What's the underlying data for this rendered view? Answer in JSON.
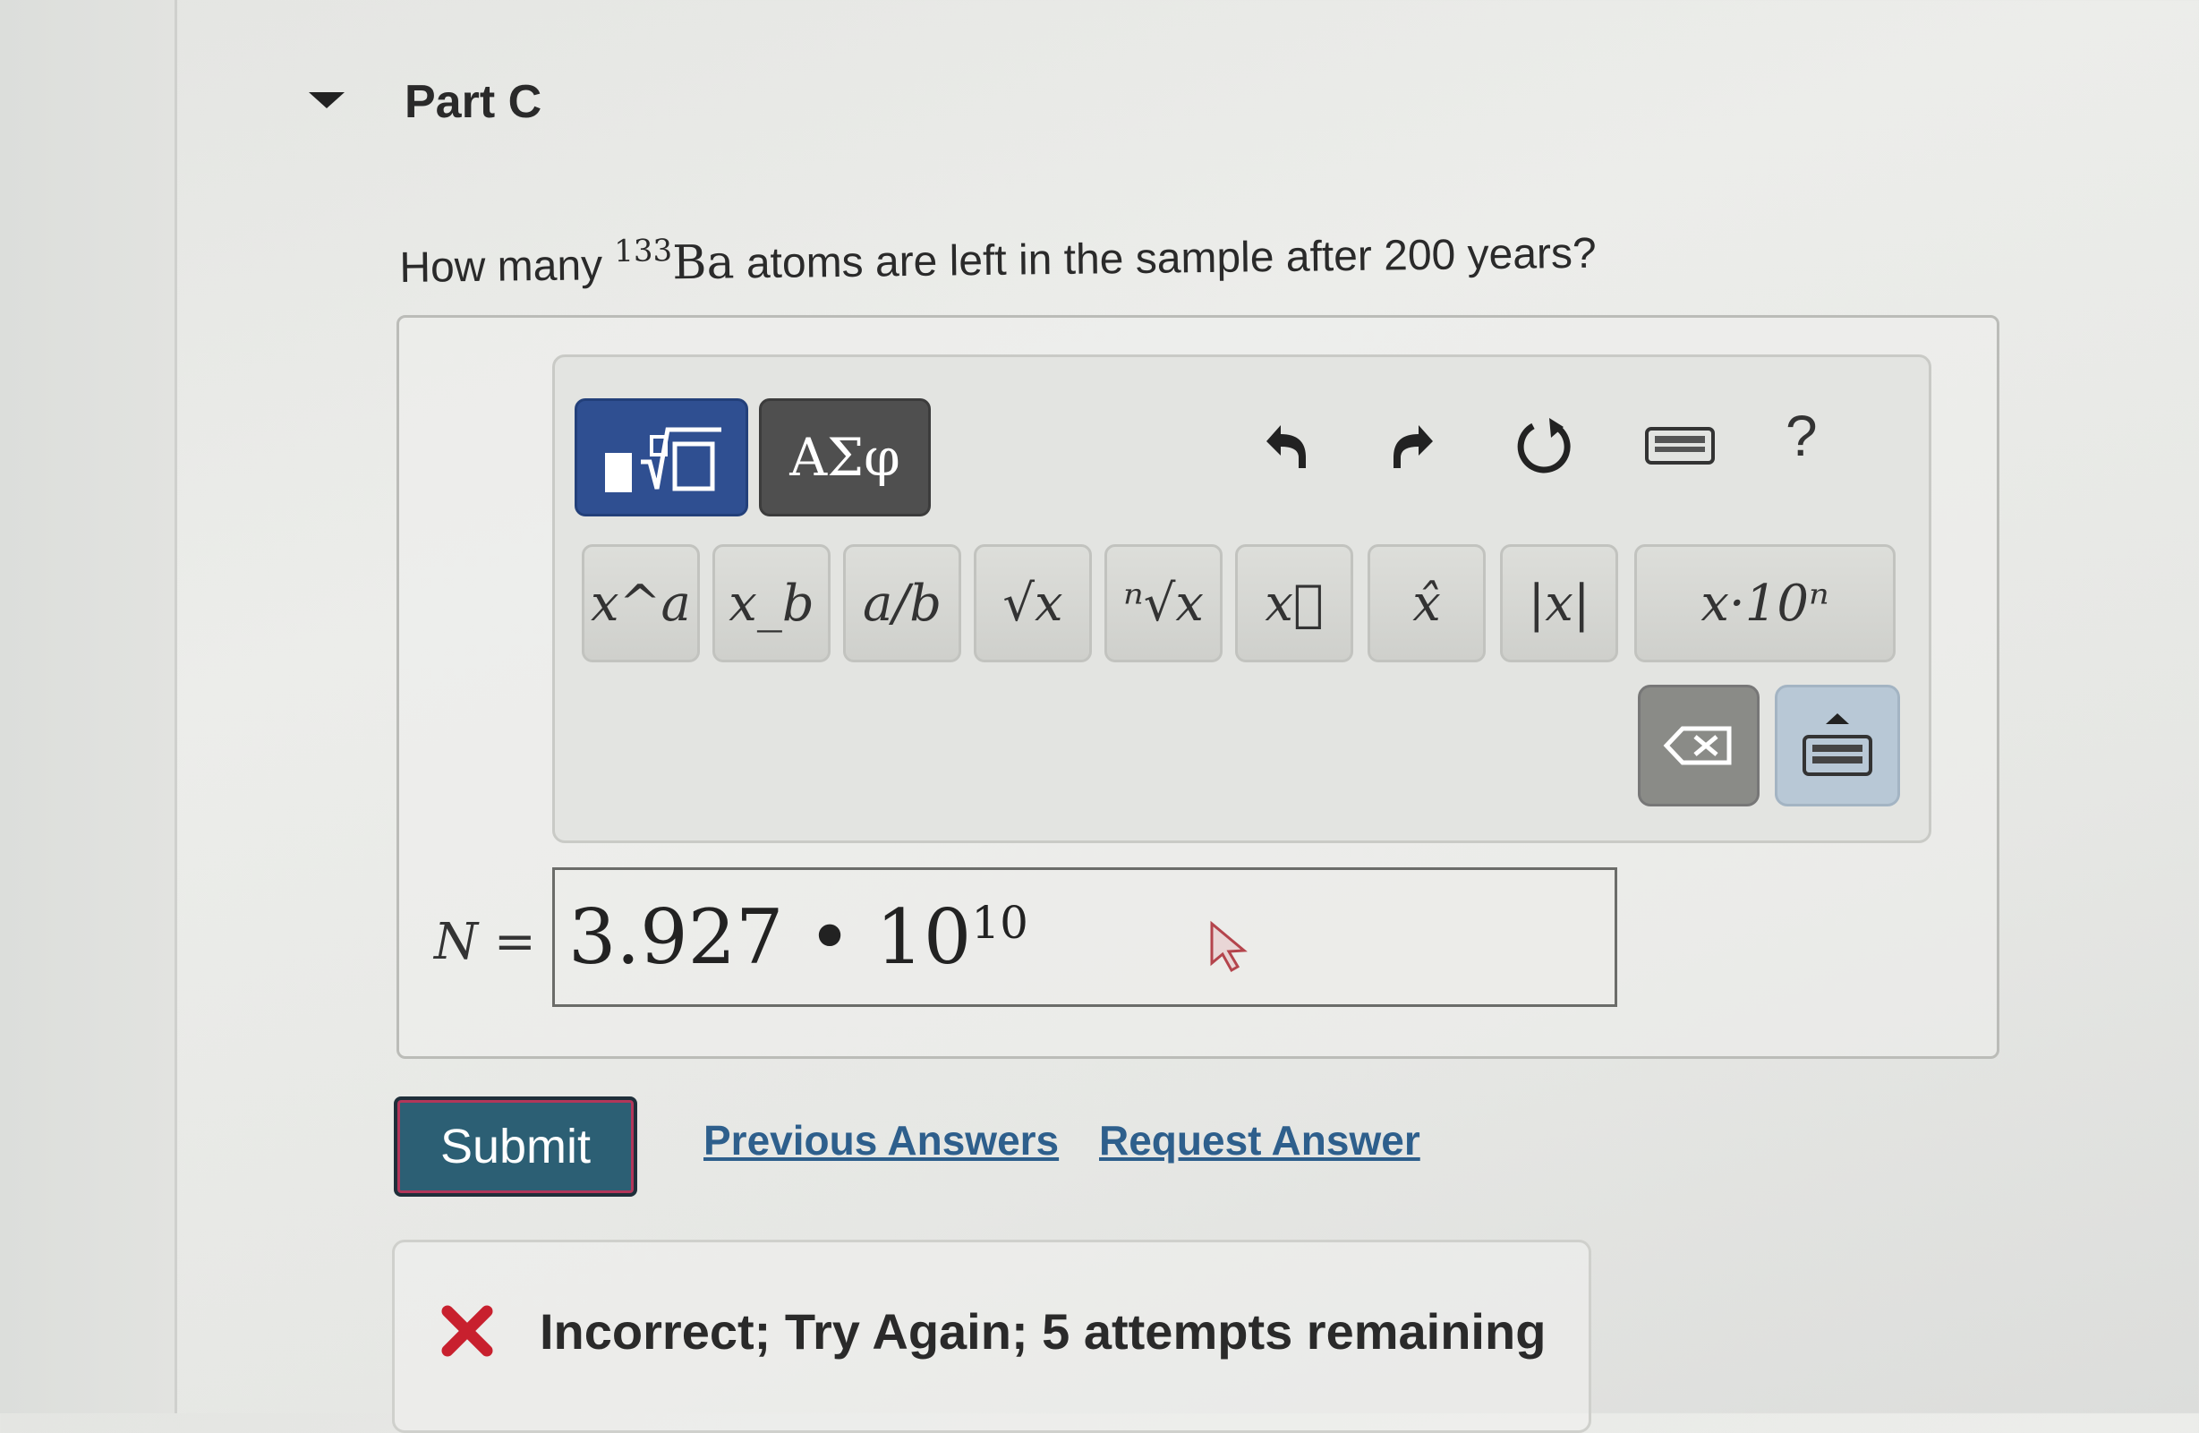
{
  "part": {
    "title": "Part C"
  },
  "question": {
    "prefix": "How many",
    "isotope_mass": "133",
    "element": "Ba",
    "suffix": "atoms are left in the sample after 200 years?"
  },
  "toolbar": {
    "templates_icon": "templates-icon",
    "greek_label": "ΑΣφ",
    "icons": [
      "undo-icon",
      "redo-icon",
      "reset-icon",
      "keyboard-icon"
    ],
    "help_label": "?"
  },
  "keys": {
    "power": "x^a",
    "subscript": "x_b",
    "fraction": "a/b",
    "sqrt": "√x",
    "nth_root": "ⁿ√x",
    "vector": "x⃗",
    "unit_vector": "x̂",
    "abs": "|x|",
    "sci_notation": "x·10ⁿ"
  },
  "answer": {
    "variable": "N",
    "equals": "=",
    "mantissa": "3.927",
    "dot": "•",
    "base": "10",
    "exponent": "10"
  },
  "actions": {
    "submit_label": "Submit",
    "previous_answers_label": "Previous Answers",
    "request_answer_label": "Request Answer"
  },
  "feedback": {
    "message": "Incorrect; Try Again; 5 attempts remaining"
  },
  "colors": {
    "submit_bg": "#2c5f74",
    "link": "#2e5f8c",
    "templates_tab": "#2f4f91",
    "error_x": "#c8202e"
  }
}
